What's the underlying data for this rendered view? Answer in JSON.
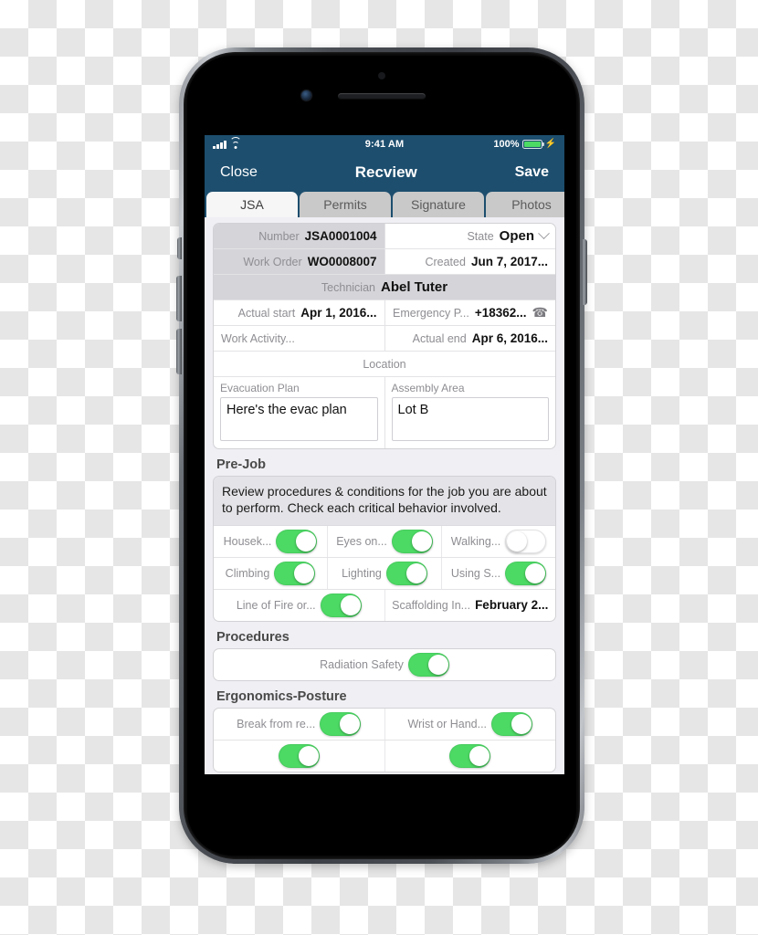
{
  "status_bar": {
    "time": "9:41 AM",
    "battery_percent": "100%",
    "charging_glyph": "⚡",
    "signal_icon": "cellular-signal-icon",
    "wifi_icon": "wifi-icon"
  },
  "nav": {
    "close_label": "Close",
    "title": "Recview",
    "save_label": "Save"
  },
  "tabs": [
    {
      "label": "JSA",
      "active": true
    },
    {
      "label": "Permits",
      "active": false
    },
    {
      "label": "Signature",
      "active": false
    },
    {
      "label": "Photos",
      "active": false
    }
  ],
  "details": {
    "number_label": "Number",
    "number_value": "JSA0001004",
    "state_label": "State",
    "state_value": "Open",
    "work_order_label": "Work Order",
    "work_order_value": "WO0008007",
    "created_label": "Created",
    "created_value": "Jun 7, 2017...",
    "technician_label": "Technician",
    "technician_value": "Abel Tuter",
    "actual_start_label": "Actual start",
    "actual_start_value": "Apr 1, 2016...",
    "emergency_label": "Emergency P...",
    "emergency_value": "+18362...",
    "work_activity_label": "Work Activity...",
    "actual_end_label": "Actual end",
    "actual_end_value": "Apr 6, 2016...",
    "location_label": "Location",
    "evacuation_plan_label": "Evacuation Plan",
    "evacuation_plan_value": "Here's the evac plan",
    "assembly_area_label": "Assembly Area",
    "assembly_area_value": "Lot B"
  },
  "pre_job": {
    "section_title": "Pre-Job",
    "instructions": "Review procedures & conditions for the job you are about to perform. Check each critical behavior involved.",
    "toggles_row1": [
      {
        "label": "Housek...",
        "on": true
      },
      {
        "label": "Eyes on...",
        "on": true
      },
      {
        "label": "Walking...",
        "on": false
      }
    ],
    "toggles_row2": [
      {
        "label": "Climbing",
        "on": true
      },
      {
        "label": "Lighting",
        "on": true
      },
      {
        "label": "Using S...",
        "on": true
      }
    ],
    "line_of_fire_label": "Line of Fire or...",
    "line_of_fire_on": true,
    "scaffolding_label": "Scaffolding In...",
    "scaffolding_value": "February 2..."
  },
  "procedures": {
    "section_title": "Procedures",
    "radiation_safety_label": "Radiation Safety",
    "radiation_safety_on": true
  },
  "ergonomics": {
    "section_title": "Ergonomics-Posture",
    "break_label": "Break from re...",
    "break_on": true,
    "wrist_label": "Wrist or Hand...",
    "wrist_on": true
  },
  "colors": {
    "nav_blue": "#1d4e6e",
    "switch_green": "#4cd964",
    "content_grey": "#efeff4"
  }
}
